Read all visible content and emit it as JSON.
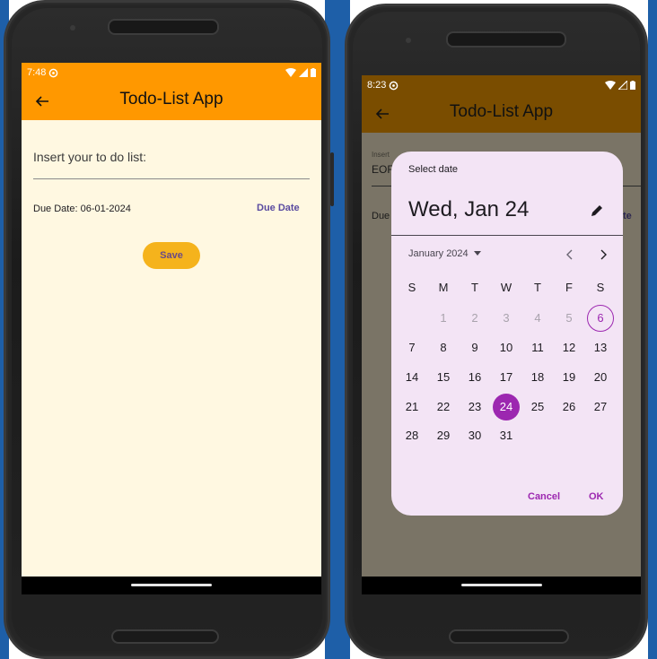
{
  "colors": {
    "appbar": "#ff9800",
    "body_bg": "#fff8e1",
    "save_button": "#f5b31c",
    "accent": "#9c27b0",
    "dialog_bg": "#f3e4f5"
  },
  "left": {
    "status_time": "7:48",
    "app_title": "Todo-List App",
    "input_label": "Insert your to do list:",
    "due_date_text": "Due Date: 06-01-2024",
    "due_date_button": "Due Date",
    "save_button": "Save"
  },
  "right": {
    "status_time": "8:23",
    "app_title": "Todo-List App",
    "partial_label": "Insert",
    "partial_value": "EOF",
    "partial_due": "Due",
    "partial_due_button": "te",
    "dialog": {
      "header": "Select date",
      "selected_date": "Wed, Jan 24",
      "month_label": "January 2024",
      "weekdays": [
        "S",
        "M",
        "T",
        "W",
        "T",
        "F",
        "S"
      ],
      "week1": [
        "1",
        "2",
        "3",
        "4",
        "5",
        "6"
      ],
      "week2": [
        "7",
        "8",
        "9",
        "10",
        "11",
        "12",
        "13"
      ],
      "week3": [
        "14",
        "15",
        "16",
        "17",
        "18",
        "19",
        "20"
      ],
      "week4": [
        "21",
        "22",
        "23",
        "24",
        "25",
        "26",
        "27"
      ],
      "week5": [
        "28",
        "29",
        "30",
        "31"
      ],
      "cancel": "Cancel",
      "ok": "OK"
    }
  }
}
